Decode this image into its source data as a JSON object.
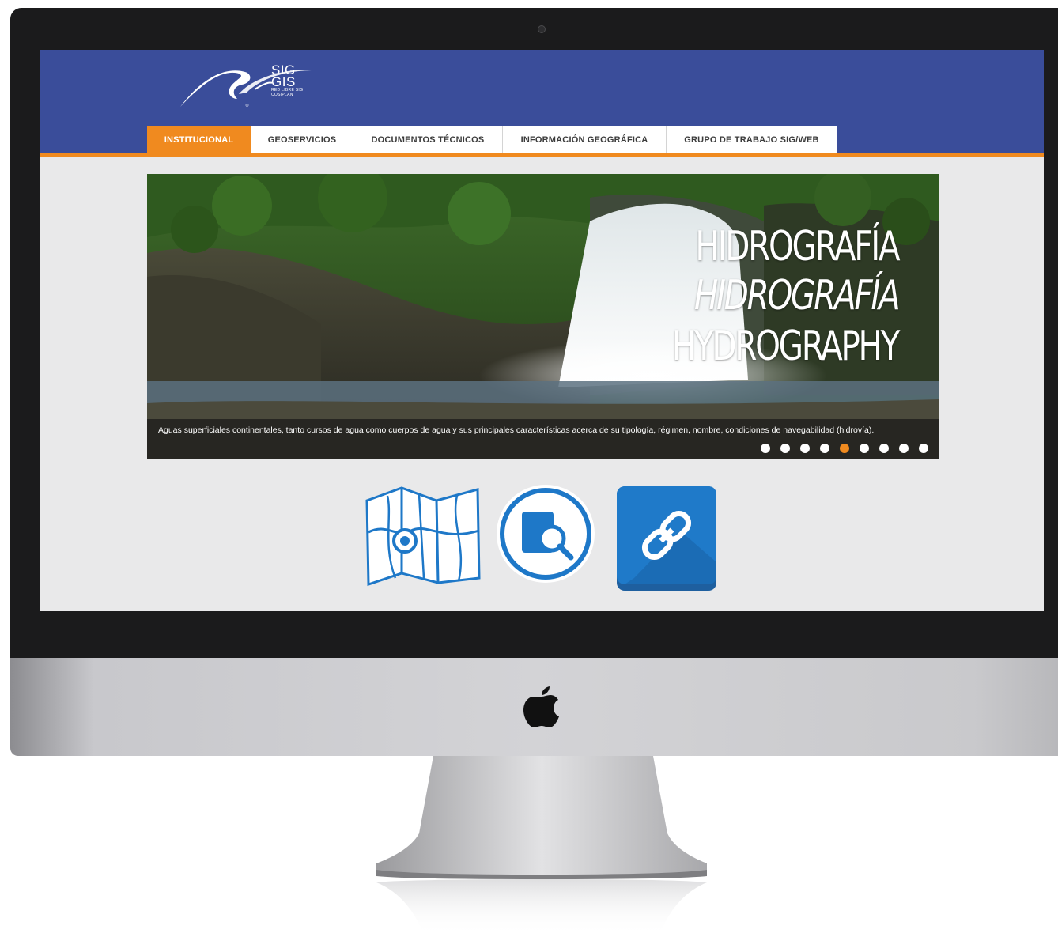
{
  "logo": {
    "line1": "SIG",
    "line2": "GIS",
    "line3": "RED LIBRE SIG",
    "line4": "COSIPLAN"
  },
  "nav": [
    {
      "label": "INSTITUCIONAL",
      "active": true
    },
    {
      "label": "GEOSERVICIOS",
      "active": false
    },
    {
      "label": "DOCUMENTOS TÉCNICOS",
      "active": false
    },
    {
      "label": "INFORMACIÓN GEOGRÁFICA",
      "active": false
    },
    {
      "label": "GRUPO DE TRABAJO SIG/WEB",
      "active": false
    }
  ],
  "slider": {
    "title_es": "HIDROGRAFÍA",
    "title_pt": "HIDROGRAFÍA",
    "title_en": "HYDROGRAPHY",
    "caption": "Aguas superficiales continentales, tanto cursos de agua como cuerpos de agua y sus principales características acerca de su tipología, régimen, nombre, condiciones de navegabilidad (hidrovía).",
    "dot_count": 9,
    "active_dot": 5
  },
  "icons": [
    "map-icon",
    "search-document-icon",
    "link-icon"
  ],
  "colors": {
    "header": "#3a4d9a",
    "accent": "#f08a1f",
    "screen_bg": "#e9e9ea",
    "icon_blue": "#1e78c8"
  }
}
